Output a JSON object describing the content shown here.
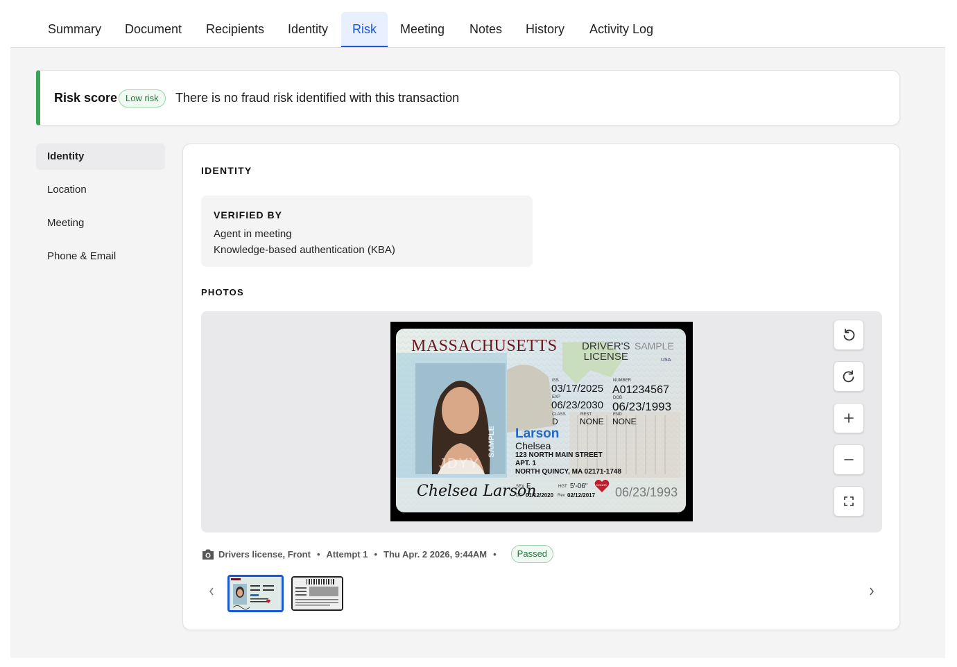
{
  "tabs": [
    {
      "label": "Summary"
    },
    {
      "label": "Document"
    },
    {
      "label": "Recipients"
    },
    {
      "label": "Identity"
    },
    {
      "label": "Risk"
    },
    {
      "label": "Meeting"
    },
    {
      "label": "Notes"
    },
    {
      "label": "History"
    },
    {
      "label": "Activity Log"
    }
  ],
  "active_tab": "Risk",
  "risk": {
    "title": "Risk score",
    "badge": "Low risk",
    "message": "There is no fraud risk identified with this transaction",
    "accent_color": "#3aa356"
  },
  "sidenav": {
    "items": [
      {
        "label": "Identity"
      },
      {
        "label": "Location"
      },
      {
        "label": "Meeting"
      },
      {
        "label": "Phone & Email"
      }
    ],
    "active": "Identity"
  },
  "identity": {
    "section_title": "IDENTITY",
    "verified_by": {
      "title": "VERIFIED BY",
      "lines": [
        "Agent in meeting",
        "Knowledge-based authentication (KBA)"
      ]
    },
    "photos_title": "PHOTOS"
  },
  "license": {
    "state": "MASSACHUSETTS",
    "type_line1": "DRIVER'S",
    "type_line2": "LICENSE",
    "sample": "SAMPLE",
    "country": "USA",
    "iss_label": "ISS",
    "iss": "03/17/2025",
    "exp_label": "EXP",
    "exp": "06/23/2030",
    "number_label": "NUMBER",
    "number": "A01234567",
    "dob_label": "DOB",
    "dob": "06/23/1993",
    "class_label": "CLASS",
    "class": "D",
    "rest_label": "REST",
    "rest": "NONE",
    "end_label": "END",
    "end": "NONE",
    "last_name": "Larson",
    "first_name": "Chelsea",
    "address1": "123 NORTH MAIN STREET",
    "address2": "APT. 1",
    "address3": "NORTH QUINCY, MA 02171-1748",
    "sex_label": "SEX",
    "sex": "F",
    "hgt_label": "HGT",
    "hgt": "5'-06\"",
    "dd_label": "DD",
    "dd": "01/12/2020",
    "rev_label": "Rev",
    "rev": "02/12/2017",
    "donor": "DONOR",
    "dob_ghost": "06/23/1993",
    "signature": "Chelsea Larson",
    "jdyy": "JDYY",
    "sample_vertical": "SAMPLE"
  },
  "photo_caption": {
    "doc": "Drivers license, Front",
    "attempt": "Attempt 1",
    "timestamp": "Thu Apr. 2 2026, 9:44AM",
    "status": "Passed"
  },
  "icons": {
    "rotate_left": "rotate-left-icon",
    "rotate_right": "rotate-right-icon",
    "zoom_in": "plus-icon",
    "zoom_out": "minus-icon",
    "fullscreen": "fullscreen-icon",
    "camera": "camera-icon"
  },
  "colors": {
    "brand_blue": "#1b56d6",
    "success_green": "#3aa356"
  }
}
